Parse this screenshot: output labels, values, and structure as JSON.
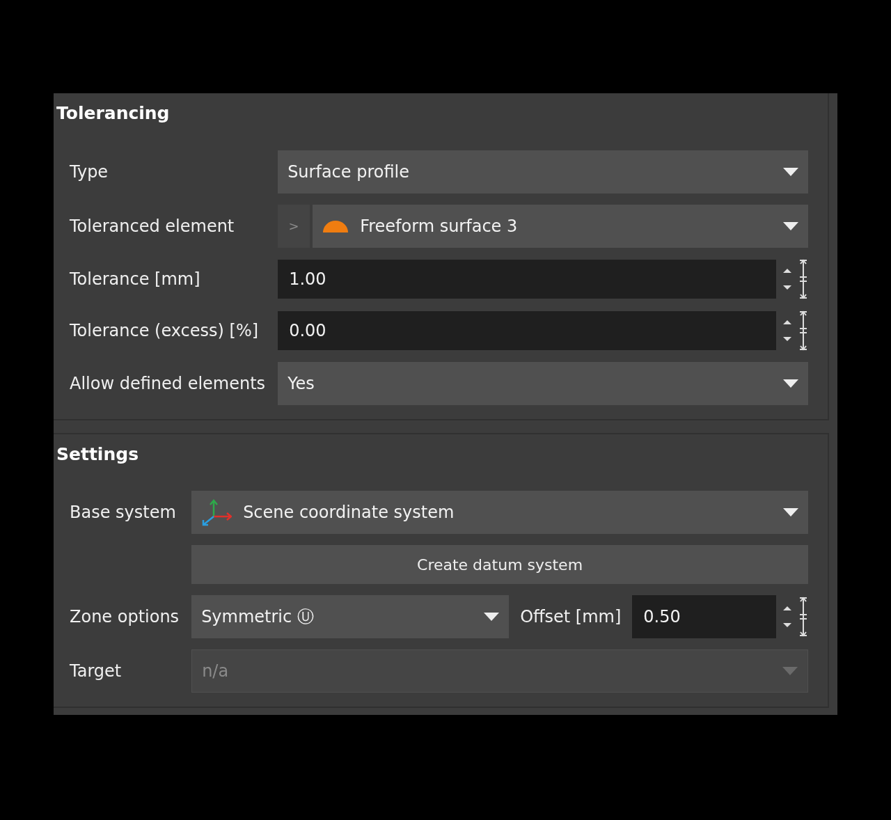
{
  "sections": [
    {
      "title": "Tolerancing",
      "rows": [
        {
          "kind": "dropdown",
          "label": "Type",
          "value": "Surface profile",
          "disabled": false
        },
        {
          "kind": "element",
          "label": "Toleranced element",
          "expander": ">",
          "value": "Freeform surface 3",
          "disabled": false
        },
        {
          "kind": "spin",
          "label": "Tolerance [mm]",
          "value": "1.00",
          "disabled": false
        },
        {
          "kind": "spin",
          "label": "Tolerance (excess) [%]",
          "value": "0.00",
          "disabled": false
        },
        {
          "kind": "dropdown",
          "label": "Allow defined elements",
          "value": "Yes",
          "disabled": false
        }
      ]
    },
    {
      "title": "Settings",
      "rows": [
        {
          "kind": "coordinate",
          "label": "Base system",
          "value": "Scene coordinate system",
          "disabled": false
        },
        {
          "kind": "button",
          "value": "Create datum system",
          "disabled": false
        },
        {
          "kind": "zone",
          "label": "Zone options",
          "value": "Symmetric Ⓤ",
          "offset_label": "Offset [mm]",
          "offset_value": "0.50",
          "disabled": false
        },
        {
          "kind": "dropdown",
          "label": "Target",
          "value": "n/a",
          "disabled": true
        }
      ]
    }
  ]
}
